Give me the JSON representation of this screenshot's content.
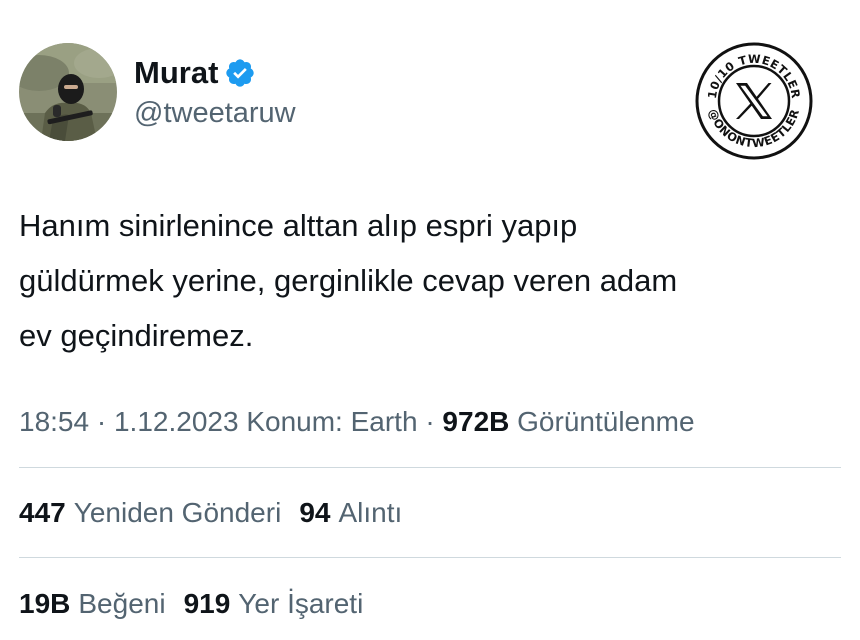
{
  "user": {
    "display_name": "Murat",
    "handle": "@tweetaruw",
    "verified": true,
    "verified_color": "#1d9bf0"
  },
  "badge": {
    "text_top": "10/10 TWEETLER",
    "text_bottom": "@ONONTWEETLER",
    "icon": "x-logo-icon"
  },
  "tweet": {
    "lines": [
      "Hanım sinirlenince alttan alıp espri yapıp",
      "güldürmek yerine, gerginlikle cevap veren adam",
      "ev geçindiremez."
    ]
  },
  "meta": {
    "time": "18:54",
    "sep1": "·",
    "date": "1.12.2023",
    "location": "Konum: Earth",
    "sep2": "·",
    "views_count": "972B",
    "views_label": "Görüntülenme"
  },
  "stats_row1": [
    {
      "count": "447",
      "label": "Yeniden Gönderi"
    },
    {
      "count": "94",
      "label": "Alıntı"
    }
  ],
  "stats_row2": [
    {
      "count": "19B",
      "label": "Beğeni"
    },
    {
      "count": "919",
      "label": "Yer İşareti"
    }
  ],
  "colors": {
    "text_primary": "#0f1419",
    "text_secondary": "#536471",
    "divider": "#cfd9de"
  }
}
